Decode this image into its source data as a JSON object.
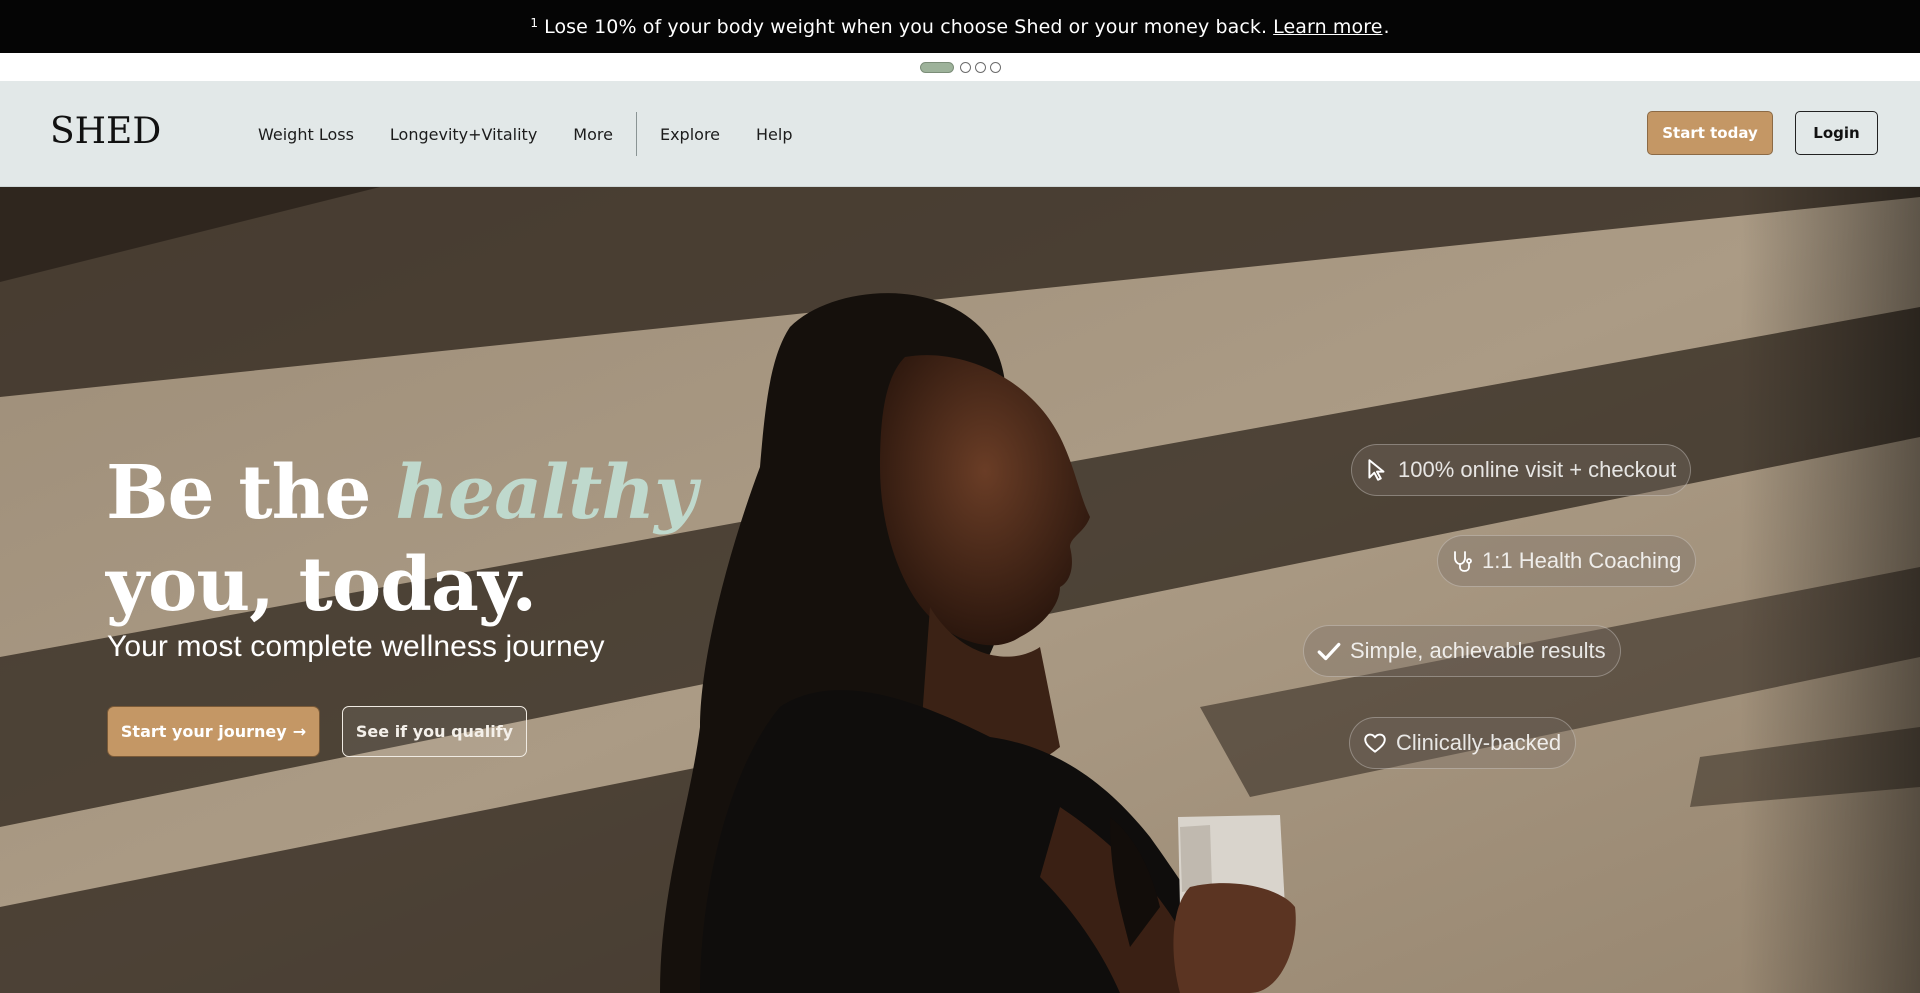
{
  "announcement": {
    "footnote": "1",
    "text": "Lose 10% of your body weight when you choose Shed or your money back.",
    "link": "Learn more",
    "end": "."
  },
  "carousel": {
    "count": 4,
    "active_index": 0
  },
  "header": {
    "logo": "SHED",
    "nav": [
      "Weight Loss",
      "Longevity+Vitality",
      "More",
      "Explore",
      "Help"
    ],
    "start_today": "Start today",
    "login": "Login"
  },
  "hero": {
    "headline_part1": "Be the ",
    "headline_accent": "healthy",
    "headline_part2": "you, today.",
    "subheadline": "Your most complete wellness journey",
    "cta_primary": "Start your journey",
    "cta_primary_arrow": "→",
    "cta_secondary": "See if you qualify",
    "features": [
      {
        "icon": "cursor-icon",
        "label": "100% online visit + checkout"
      },
      {
        "icon": "stethoscope-icon",
        "label": "1:1 Health Coaching"
      },
      {
        "icon": "checkmark-icon",
        "label": "Simple, achievable results"
      },
      {
        "icon": "heart-icon",
        "label": "Clinically-backed"
      }
    ]
  },
  "colors": {
    "brand_gold": "#c49765",
    "accent_mint": "#bfd9cd",
    "header_bg": "#e2e8e8",
    "announce_bg": "#050505"
  }
}
